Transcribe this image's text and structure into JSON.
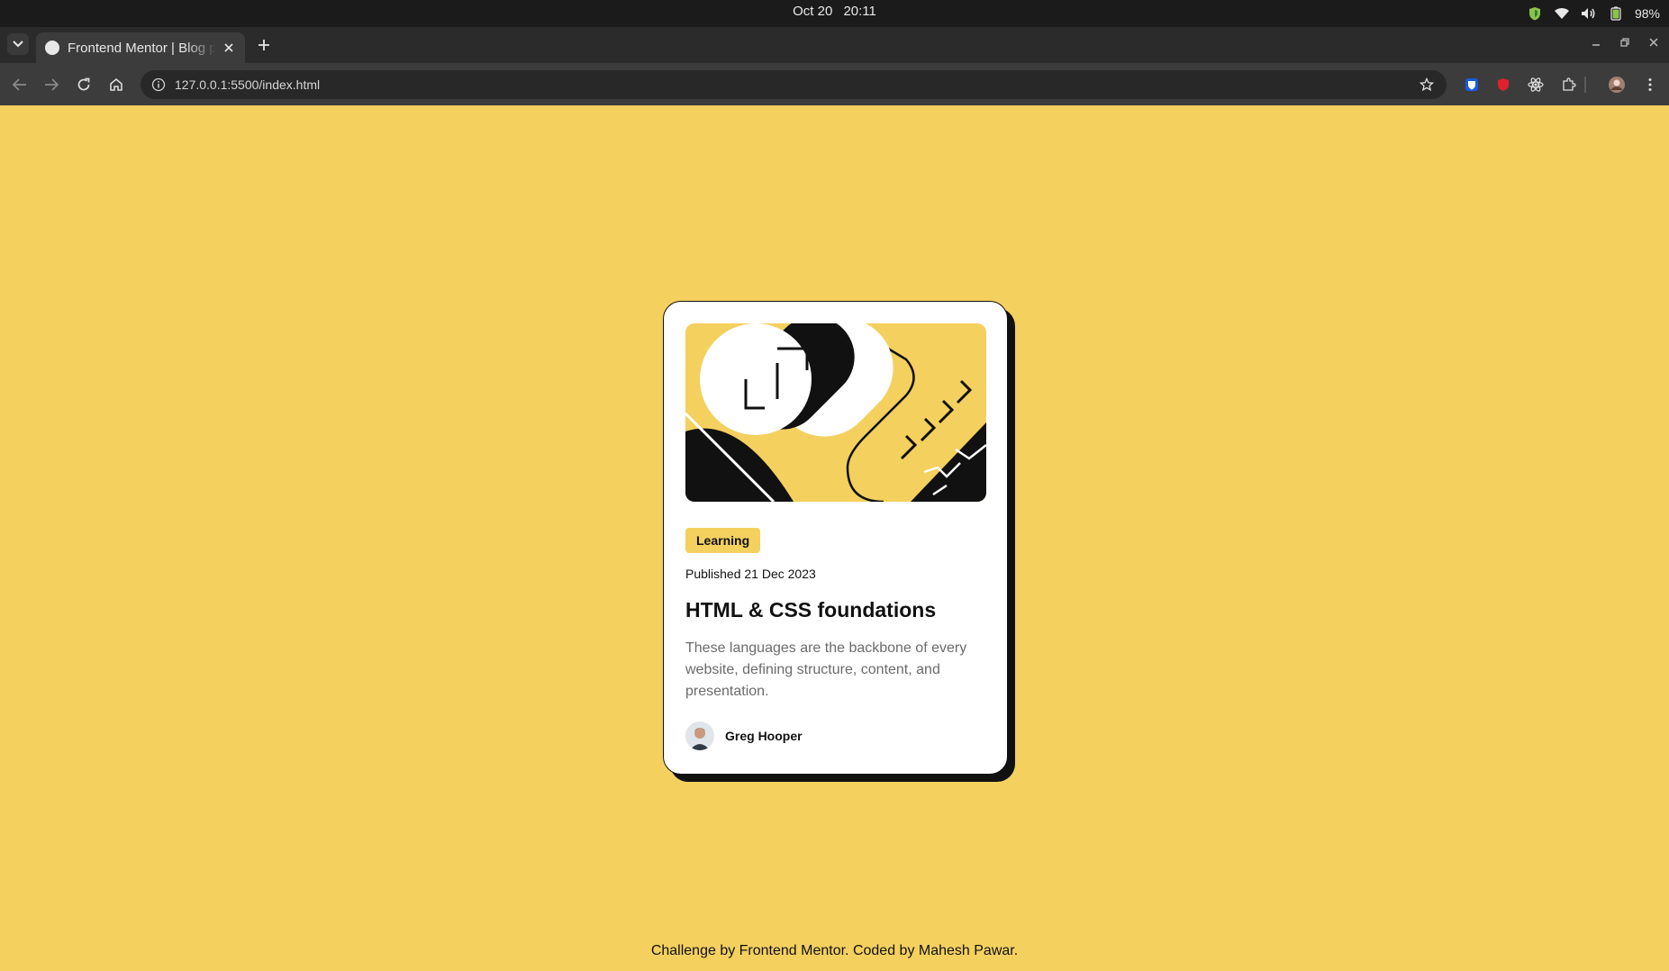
{
  "os": {
    "date": "Oct 20",
    "time": "20:11",
    "battery": "98%"
  },
  "browser": {
    "tab_title": "Frontend Mentor | Blog preview card",
    "url": "127.0.0.1:5500/index.html"
  },
  "card": {
    "tag": "Learning",
    "published": "Published 21 Dec 2023",
    "title": "HTML & CSS foundations",
    "description": "These languages are the backbone of every website, defining structure, content, and presentation.",
    "author": "Greg Hooper"
  },
  "footer": {
    "text": "Challenge by Frontend Mentor. Coded by Mahesh Pawar."
  },
  "colors": {
    "page_bg": "#f4d05e",
    "card_bg": "#ffffff",
    "ink": "#111111",
    "muted_text": "#6b6b6b"
  }
}
